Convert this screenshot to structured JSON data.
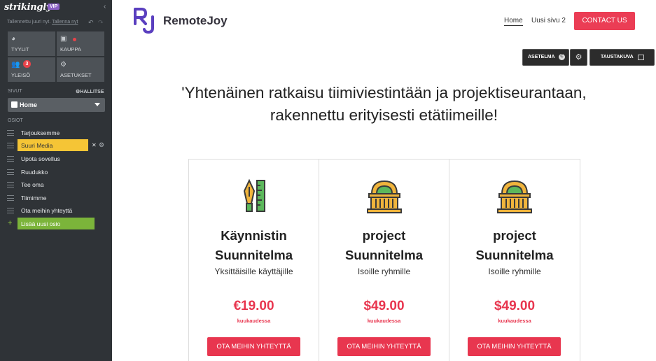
{
  "sidebar": {
    "brand": "strikingly",
    "vip": "VIP",
    "saved_text": "Tallennettu juuri nyt.",
    "save_now": "Tallenna nyt",
    "tiles": [
      {
        "label": "TYYLIT",
        "icon": "palette-icon"
      },
      {
        "label": "KAUPPA",
        "icon": "shopping-bag-icon"
      },
      {
        "label": "YLEISÖ",
        "icon": "users-icon",
        "badge": "3"
      },
      {
        "label": "ASETUKSET",
        "icon": "gear-icon"
      }
    ],
    "pages_label": "SIVUT",
    "manage_label": "HALLITSE",
    "current_page": "Home",
    "sections_label": "OSIOT",
    "sections": [
      "Tarjouksemme",
      "Suuri Media",
      "Upota sovellus",
      "Ruudukko",
      "Tee oma",
      "Tiimimme",
      "Ota meihin yhteyttä"
    ],
    "add_section": "Lisää uusi osio"
  },
  "header": {
    "logo_text": "RemoteJoy",
    "nav": [
      "Home",
      "Uusi sivu 2"
    ],
    "cta": "CONTACT US"
  },
  "toolbar": {
    "settings": "ASETELMA",
    "background": "TAUSTAKUVA"
  },
  "hero": {
    "line1": "'Yhtenäinen ratkaisu tiimiviestintään ja projektiseurantaan,",
    "line2": "rakennettu erityisesti etätiimeille!"
  },
  "plans": [
    {
      "title1": "Käynnistin",
      "title2": "Suunnitelma",
      "subtitle": "Yksittäisille käyttäjille",
      "price": "€19.00",
      "period": "kuukaudessa",
      "button": "OTA MEIHIN YHTEYTTÄ",
      "icon": "ruler-pen-icon"
    },
    {
      "title1": "project",
      "title2": "Suunnitelma",
      "subtitle": "Isoille ryhmille",
      "price": "$49.00",
      "period": "kuukaudessa",
      "button": "OTA MEIHIN YHTEYTTÄ",
      "icon": "building-icon"
    },
    {
      "title1": "project",
      "title2": "Suunnitelma",
      "subtitle": "Isoille ryhmille",
      "price": "$49.00",
      "period": "kuukaudessa",
      "button": "OTA MEIHIN YHTEYTTÄ",
      "icon": "building-icon"
    }
  ]
}
